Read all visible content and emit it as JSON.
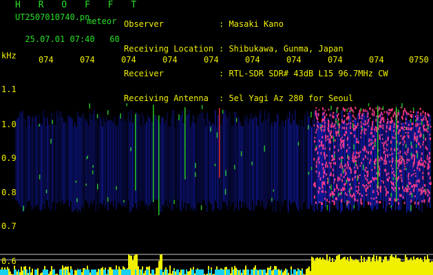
{
  "header": {
    "title": "H R O F F T",
    "filename": "UT2507010740.pn",
    "mode": "meteor",
    "date": "25.07.01 07:40",
    "interval": "60"
  },
  "info": {
    "labels": [
      "Observer",
      "Receiving Location",
      "Receiver",
      "Receiving Antenna"
    ],
    "values": [
      ": Masaki Kano",
      ": Shibukawa, Gunma, Japan",
      ": RTL-SDR SDR# 43dB L15 96.7MHz CW",
      ": 5el Yagi Az 280 for Seoul"
    ]
  },
  "chart_data": {
    "type": "heatmap",
    "title": "",
    "ylabel": "kHz",
    "yticks": [
      "1.1",
      "1.0",
      "0.9",
      "0.8",
      "0.7",
      "0.6"
    ],
    "xticks": [
      "074",
      "074",
      "074",
      "074",
      "074",
      "074",
      "074",
      "074",
      "074",
      "0750"
    ]
  },
  "colors": {
    "background": "#000000",
    "text_green": "#28e028",
    "text_yellow": "#f0f000",
    "noise_blue": "#1a28ff",
    "hot_pink": "#ff3c8c",
    "signal_green": "#2ee02e"
  }
}
